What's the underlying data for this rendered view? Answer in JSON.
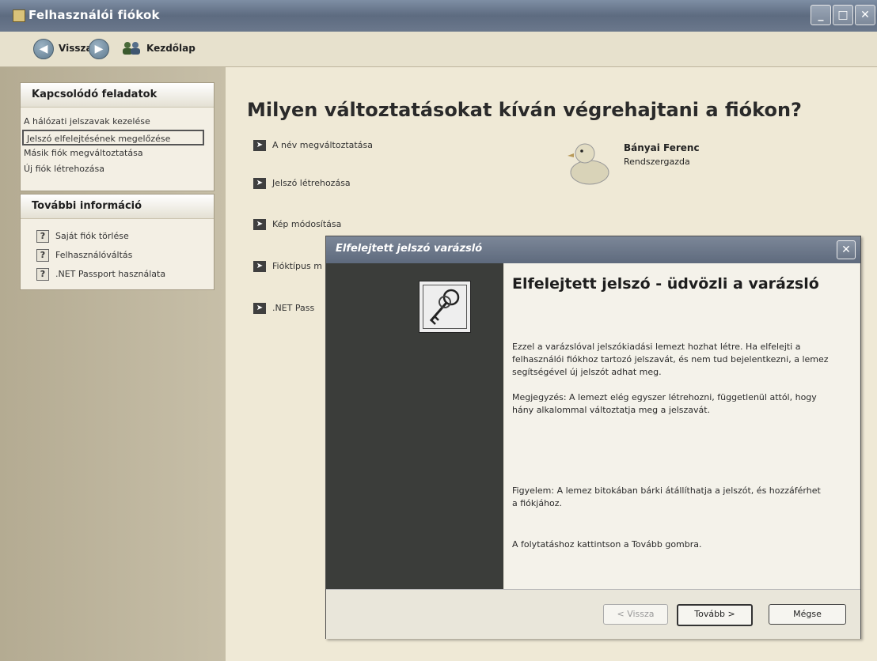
{
  "window": {
    "title": "Felhasználói fiókok",
    "controls": [
      "_",
      "□",
      "✕"
    ]
  },
  "toolbar": {
    "back_label": "Vissza",
    "home_label": "Kezdőlap"
  },
  "sidebar": {
    "related_tasks": {
      "header": "Kapcsolódó feladatok",
      "items": [
        {
          "label": "A hálózati jelszavak kezelése"
        },
        {
          "label": "Jelszó elfelejtésének megelőzése"
        },
        {
          "label": "Másik fiók megváltoztatása"
        },
        {
          "label": "Új fiók létrehozása"
        }
      ]
    },
    "more_info": {
      "header": "További információ",
      "items": [
        {
          "label": "Saját fiók törlése"
        },
        {
          "label": "Felhasználóváltás"
        },
        {
          "label": ".NET Passport használata"
        }
      ]
    }
  },
  "main": {
    "heading": "Milyen változtatásokat kíván végrehajtani a fiókon?",
    "actions": [
      {
        "label": "A név megváltoztatása"
      },
      {
        "label": "Jelszó létrehozása"
      },
      {
        "label": "Kép módosítása"
      },
      {
        "label": "Fióktípus m"
      },
      {
        "label": ".NET Pass"
      }
    ],
    "user": {
      "name": "Bányai Ferenc",
      "role": "Rendszergazda"
    }
  },
  "wizard": {
    "title": "Elfelejtett jelszó varázsló",
    "heading": "Elfelejtett jelszó - üdvözli a varázsló",
    "intro": "Ezzel a varázslóval jelszókiadási lemezt hozhat létre. Ha elfelejti a felhasználói fiókhoz tartozó jelszavát, és nem tud bejelentkezni, a lemez segítségével új jelszót adhat meg.",
    "note": "Megjegyzés: A lemezt elég egyszer létrehozni, függetlenül attól, hogy hány alkalommal változtatja meg a jelszavát.",
    "warning": "Figyelem: A lemez bitokában bárki átállíthatja a jelszót, és hozzáférhet  a fiókjához.",
    "continue": "A folytatáshoz kattintson a Tovább gombra.",
    "buttons": {
      "back": "< Vissza",
      "next": "Tovább >",
      "cancel": "Mégse"
    }
  }
}
